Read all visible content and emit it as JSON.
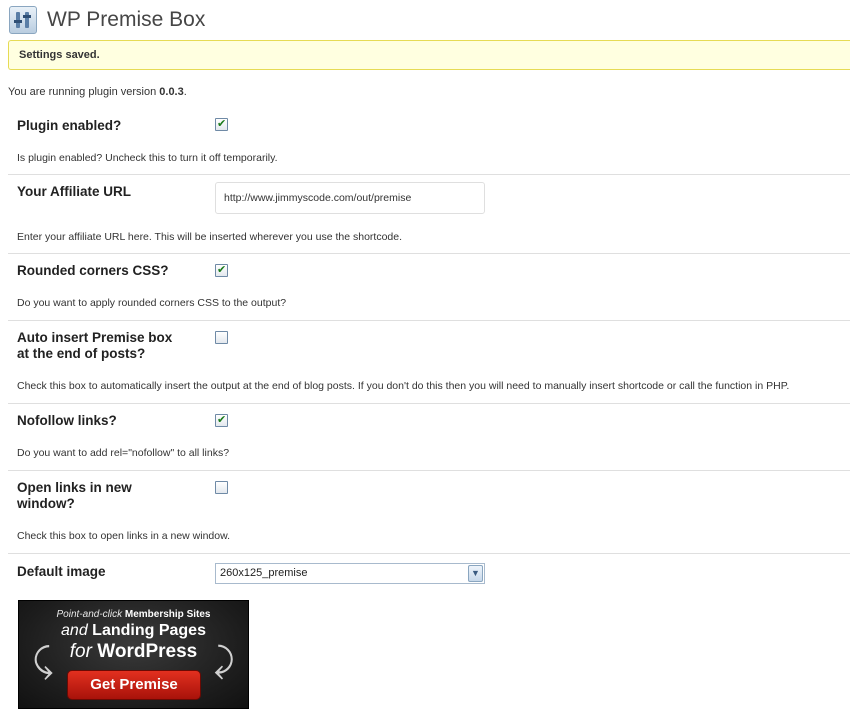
{
  "page": {
    "title": "WP Premise Box",
    "icon": "plugin-settings-icon"
  },
  "notice": {
    "text": "Settings saved."
  },
  "version": {
    "prefix": "You are running plugin version ",
    "number": "0.0.3",
    "suffix": "."
  },
  "settings": {
    "plugin_enabled": {
      "label": "Plugin enabled?",
      "checked": true,
      "description": "Is plugin enabled? Uncheck this to turn it off temporarily."
    },
    "affiliate_url": {
      "label": "Your Affiliate URL",
      "value": "http://www.jimmyscode.com/out/premise",
      "description": "Enter your affiliate URL here. This will be inserted wherever you use the shortcode."
    },
    "rounded_corners": {
      "label": "Rounded corners CSS?",
      "checked": true,
      "description": "Do you want to apply rounded corners CSS to the output?"
    },
    "auto_insert": {
      "label_line1": "Auto insert Premise box",
      "label_line2": "at the end of posts?",
      "checked": false,
      "description": "Check this box to automatically insert the output at the end of blog posts. If you don't do this then you will need to manually insert shortcode or call the function in PHP."
    },
    "nofollow": {
      "label": "Nofollow links?",
      "checked": true,
      "description": "Do you want to add rel=\"nofollow\" to all links?"
    },
    "new_window": {
      "label_line1": "Open links in new",
      "label_line2": "window?",
      "checked": false,
      "description": "Check this box to open links in a new window."
    },
    "default_image": {
      "label": "Default image",
      "selected": "260x125_premise"
    }
  },
  "banner": {
    "line1_pre": "Point-and-click",
    "line1_bold": "Membership Sites",
    "line2_pre": "and",
    "line2_bold": "Landing Pages",
    "line3_pre": "for",
    "line3_bold": "WordPress",
    "button": "Get Premise"
  }
}
